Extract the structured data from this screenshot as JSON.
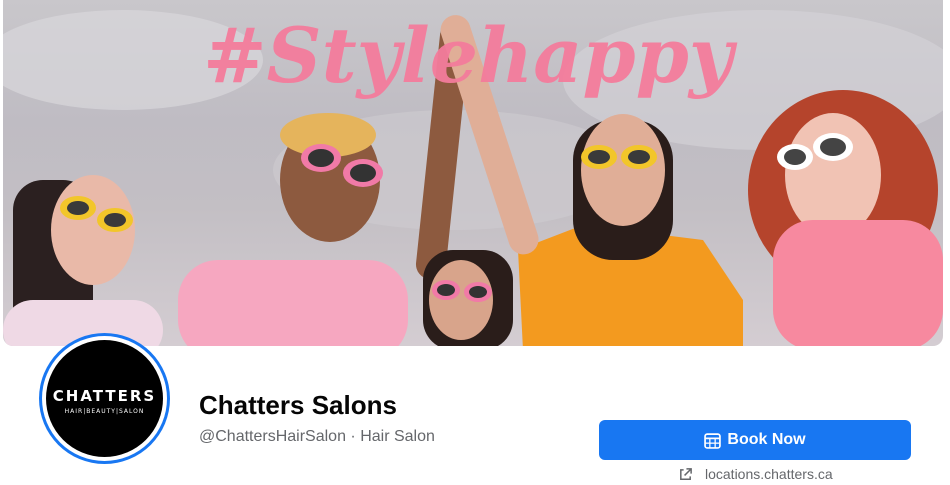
{
  "cover": {
    "hashtag": "#Stylehappy"
  },
  "profile": {
    "logo_word": "CHATTERS",
    "logo_sub": "HAIR|BEAUTY|SALON",
    "name": "Chatters Salons",
    "meta": "@ChattersHairSalon · Hair Salon"
  },
  "actions": {
    "book_label": "Book Now",
    "book_icon": "calendar-icon",
    "website_label": "locations.chatters.ca",
    "website_icon": "external-link-icon"
  },
  "colors": {
    "accent": "#1877f2",
    "hashtag": "#f47c9c"
  }
}
